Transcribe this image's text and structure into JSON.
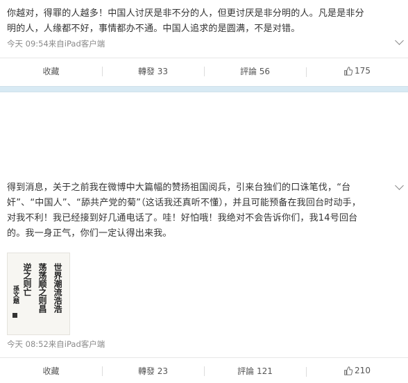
{
  "posts": [
    {
      "text_lines": [
        "你越对，得罪的人越多！中国人讨厌是非不分的人，但更讨厌是非分明的人。凡是是非分",
        "明的人，人缘都不好，事情都办不通。中国人追求的是圆满，不是对错。"
      ],
      "time": "今天 09:54",
      "source": "来自iPad客户端",
      "actions": {
        "favorite": "收藏",
        "repost": "轉發 33",
        "comment": "評論 56",
        "like": "175"
      }
    },
    {
      "text_lines": [
        "得到消息，关于之前我在微博中大篇幅的赞扬祖国阅兵，引来台独们的口诛笔伐，“台",
        "奸”、“中国人”、“舔共产党的菊”（这话我还真听不懂），并且可能预备在我回台时动手，",
        "对我不利！我已经接到好几通电话了。哇！好怕哦！我绝对不会告诉你们，我14号回台",
        "的。我一身正气，你们一定认得出来我。"
      ],
      "image_lines": [
        "世界潮流浩浩",
        "荡荡顺之则昌",
        "逆之则亡",
        "孫文題"
      ],
      "time": "今天 08:52",
      "source": "来自iPad客户端",
      "actions": {
        "favorite": "收藏",
        "repost": "轉發 23",
        "comment": "評論 121",
        "like": "210"
      }
    }
  ],
  "icons": {
    "more": "chevron-down-icon",
    "like": "thumbs-up-icon"
  },
  "colors": {
    "separator": "#d8eaf4",
    "text": "#333333",
    "meta": "#8a8a8a"
  }
}
